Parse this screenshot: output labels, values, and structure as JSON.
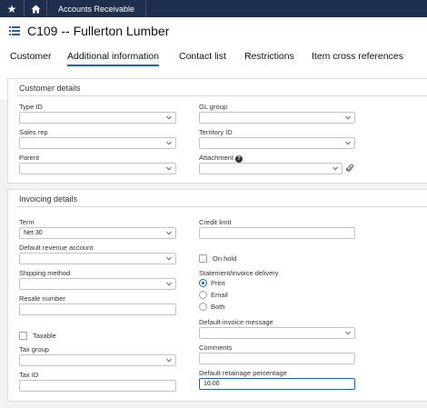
{
  "topbar": {
    "module_label": "Accounts Receivable"
  },
  "page": {
    "title": "C109 -- Fullerton Lumber"
  },
  "tabs": [
    {
      "label": "Customer"
    },
    {
      "label": "Additional information"
    },
    {
      "label": "Contact list"
    },
    {
      "label": "Restrictions"
    },
    {
      "label": "Item cross references"
    }
  ],
  "customer_details": {
    "title": "Customer details",
    "type_id": {
      "label": "Type ID",
      "value": ""
    },
    "gl_group": {
      "label": "GL group",
      "value": ""
    },
    "sales_rep": {
      "label": "Sales rep",
      "value": ""
    },
    "territory_id": {
      "label": "Territory ID",
      "value": ""
    },
    "parent": {
      "label": "Parent",
      "value": ""
    },
    "attachment": {
      "label": "Attachment",
      "value": ""
    }
  },
  "invoicing_details": {
    "title": "Invoicing details",
    "term": {
      "label": "Term",
      "value": "Net 30"
    },
    "credit_limit": {
      "label": "Credit limit",
      "value": ""
    },
    "default_revenue_account": {
      "label": "Default revenue account",
      "value": ""
    },
    "on_hold": {
      "label": "On hold",
      "checked": false
    },
    "shipping_method": {
      "label": "Shipping method",
      "value": ""
    },
    "statement_delivery": {
      "label": "Statement/invoice delivery",
      "options": [
        "Print",
        "Email",
        "Both"
      ],
      "selected": "Print"
    },
    "resale_number": {
      "label": "Resale number",
      "value": ""
    },
    "default_invoice_message": {
      "label": "Default invoice message",
      "value": ""
    },
    "taxable": {
      "label": "Taxable",
      "checked": false
    },
    "tax_group": {
      "label": "Tax group",
      "value": ""
    },
    "comments": {
      "label": "Comments",
      "value": ""
    },
    "tax_id": {
      "label": "Tax ID",
      "value": ""
    },
    "default_retainage_percentage": {
      "label": "Default retainage percentage",
      "value": "10.00"
    }
  },
  "colors": {
    "topbar": "#1e2f4d",
    "accent": "#1e63b8"
  }
}
